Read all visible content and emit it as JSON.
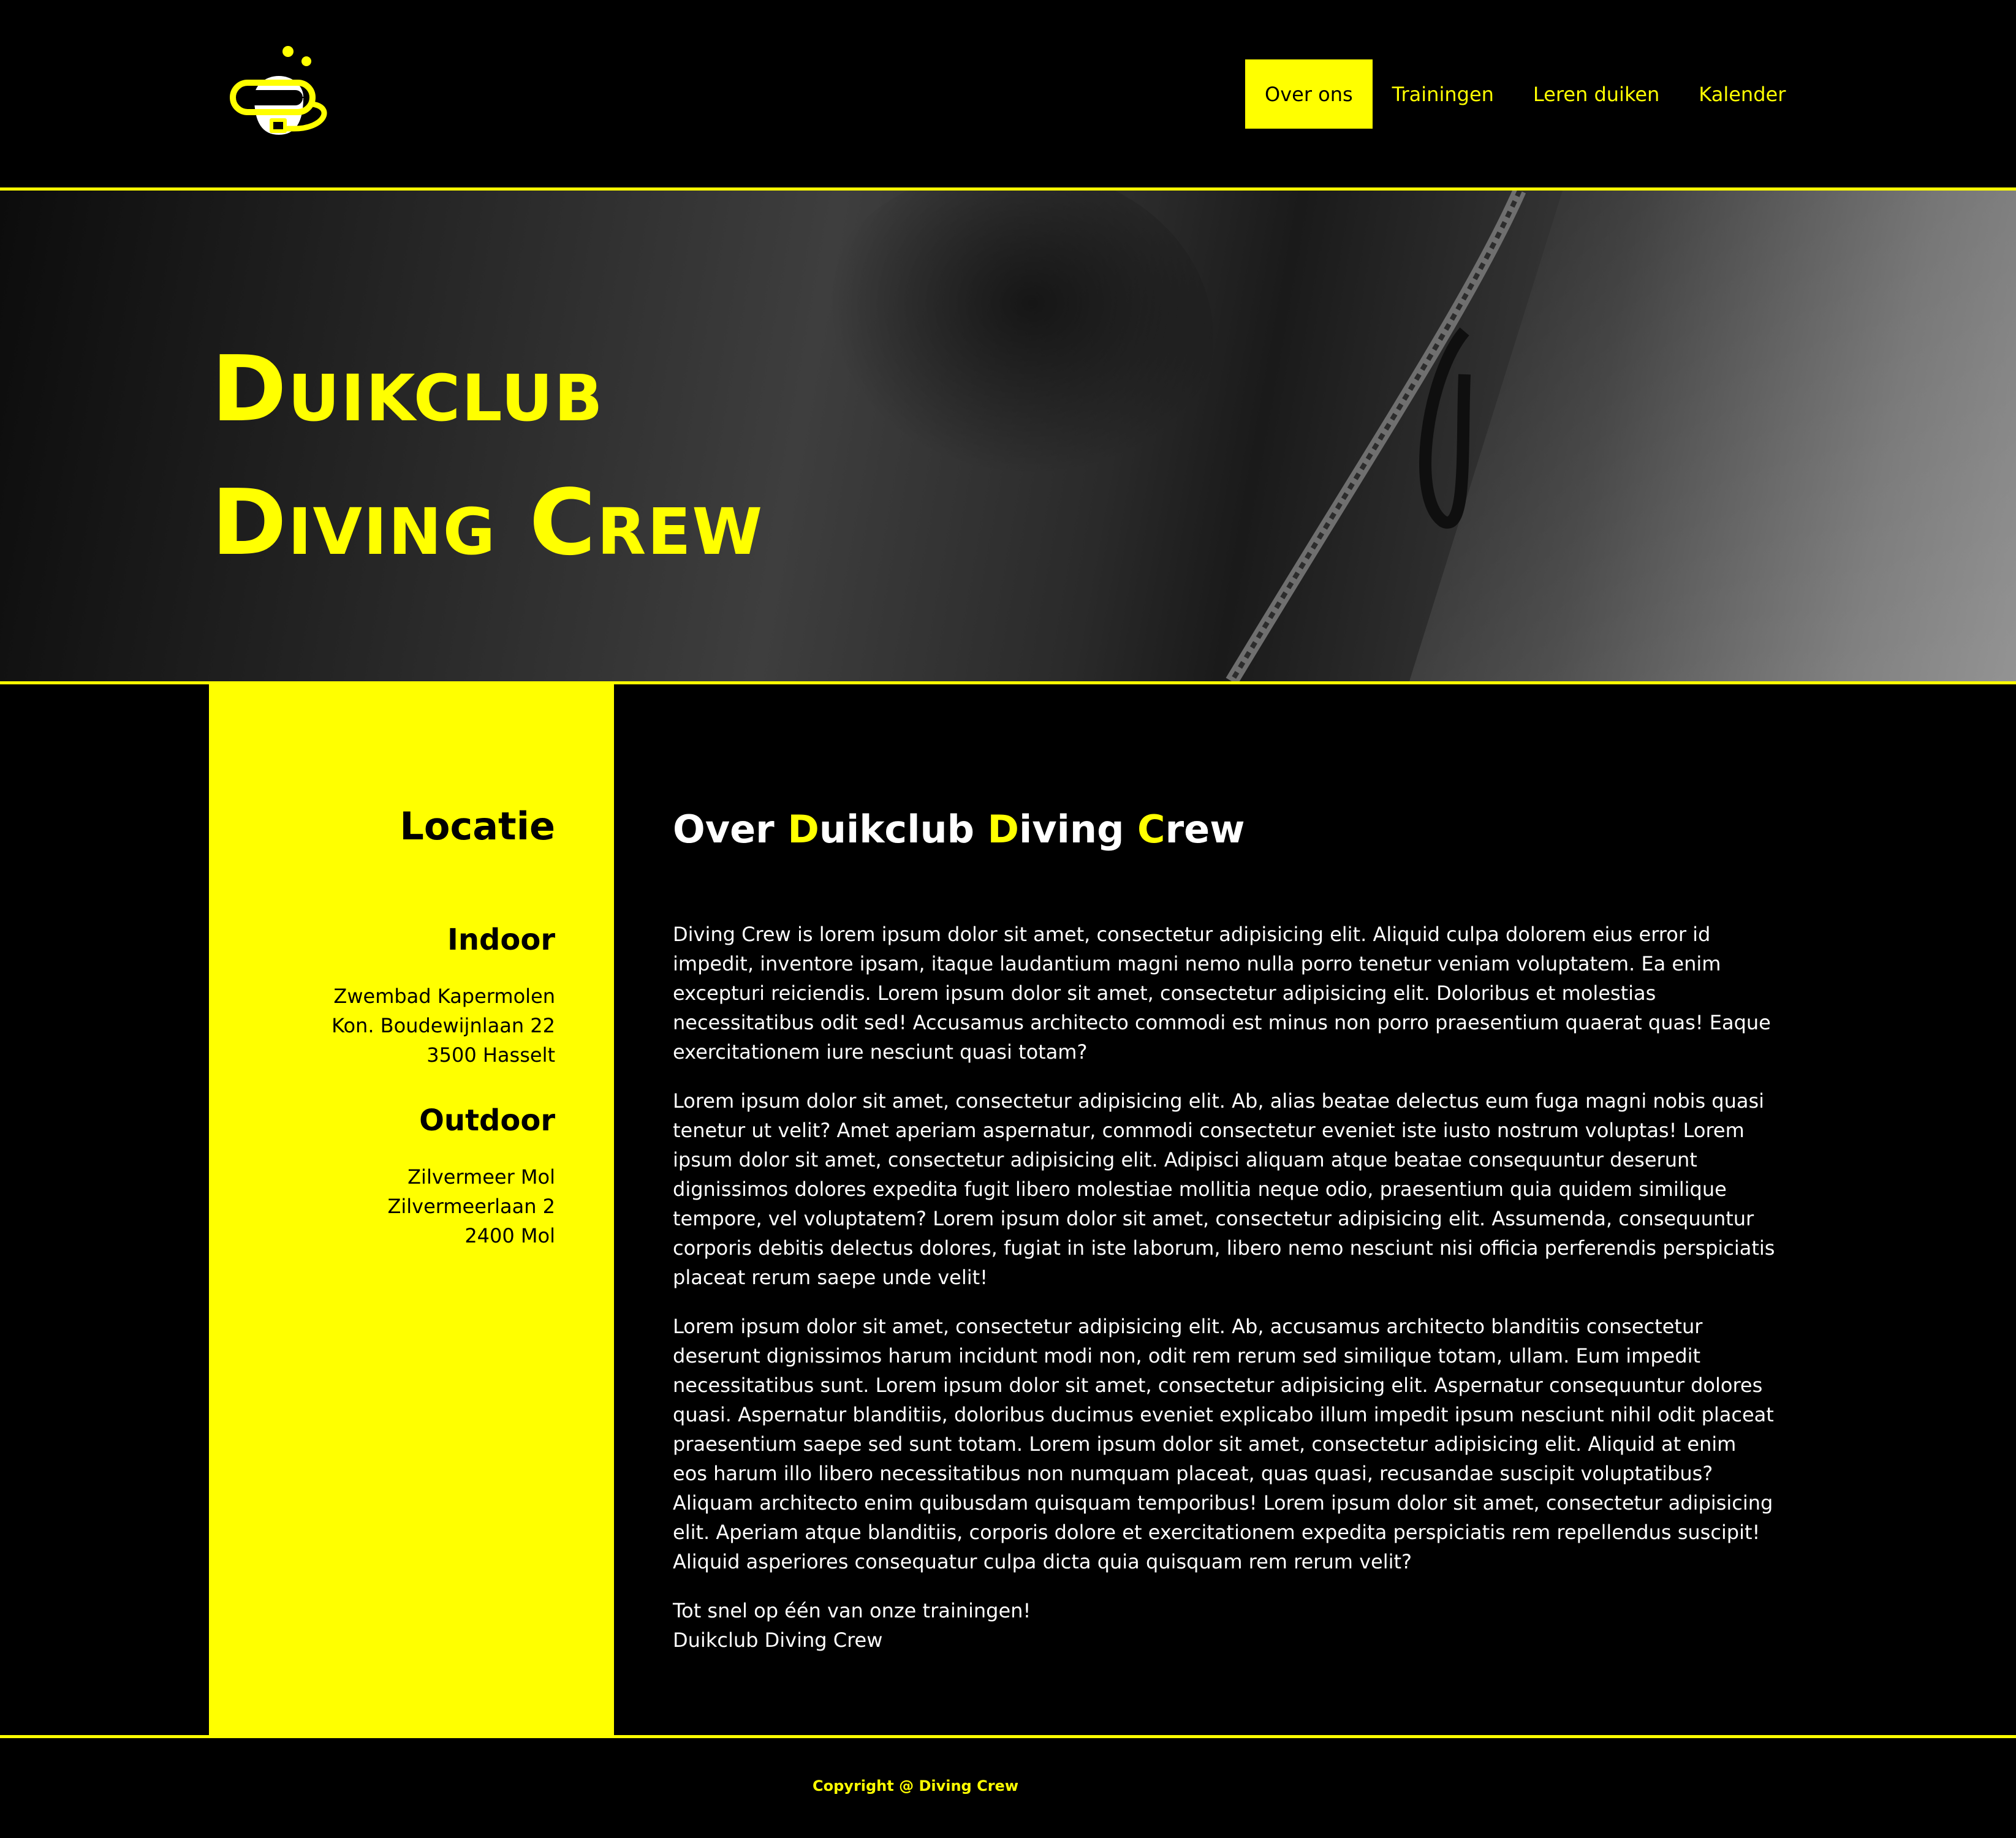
{
  "colors": {
    "accent": "#ffff00",
    "background": "#000000",
    "text": "#ffffff"
  },
  "header": {
    "logo_icon": "diver-mask-snorkel-icon",
    "nav": [
      {
        "label": "Over ons",
        "active": true
      },
      {
        "label": "Trainingen",
        "active": false
      },
      {
        "label": "Leren duiken",
        "active": false
      },
      {
        "label": "Kalender",
        "active": false
      }
    ]
  },
  "hero": {
    "title_line1": "Duikclub",
    "title_line2": "Diving Crew"
  },
  "sidebar": {
    "title": "Locatie",
    "indoor": {
      "heading": "Indoor",
      "lines": [
        "Zwembad Kapermolen",
        "Kon. Boudewijnlaan 22",
        "3500 Hasselt"
      ]
    },
    "outdoor": {
      "heading": "Outdoor",
      "lines": [
        "Zilvermeer Mol",
        "Zilvermeerlaan 2",
        "2400 Mol"
      ]
    }
  },
  "main": {
    "title_parts": [
      "Over ",
      "D",
      "uikclub ",
      "D",
      "iving ",
      "C",
      "rew"
    ],
    "paragraphs": [
      "Diving Crew is lorem ipsum dolor sit amet, consectetur adipisicing elit. Aliquid culpa dolorem eius error id impedit, inventore ipsam, itaque laudantium magni nemo nulla porro tenetur veniam voluptatem. Ea enim excepturi reiciendis. Lorem ipsum dolor sit amet, consectetur adipisicing elit. Doloribus et molestias necessitatibus odit sed! Accusamus architecto commodi est minus non porro praesentium quaerat quas! Eaque exercitationem iure nesciunt quasi totam?",
      "Lorem ipsum dolor sit amet, consectetur adipisicing elit. Ab, alias beatae delectus eum fuga magni nobis quasi tenetur ut velit? Amet aperiam aspernatur, commodi consectetur eveniet iste iusto nostrum voluptas! Lorem ipsum dolor sit amet, consectetur adipisicing elit. Adipisci aliquam atque beatae consequuntur deserunt dignissimos dolores expedita fugit libero molestiae mollitia neque odio, praesentium quia quidem similique tempore, vel voluptatem? Lorem ipsum dolor sit amet, consectetur adipisicing elit. Assumenda, consequuntur corporis debitis delectus dolores, fugiat in iste laborum, libero nemo nesciunt nisi officia perferendis perspiciatis placeat rerum saepe unde velit!",
      "Lorem ipsum dolor sit amet, consectetur adipisicing elit. Ab, accusamus architecto blanditiis consectetur deserunt dignissimos harum incidunt modi non, odit rem rerum sed similique totam, ullam. Eum impedit necessitatibus sunt. Lorem ipsum dolor sit amet, consectetur adipisicing elit. Aspernatur consequuntur dolores quasi. Aspernatur blanditiis, doloribus ducimus eveniet explicabo illum impedit ipsum nesciunt nihil odit placeat praesentium saepe sed sunt totam. Lorem ipsum dolor sit amet, consectetur adipisicing elit. Aliquid at enim eos harum illo libero necessitatibus non numquam placeat, quas quasi, recusandae suscipit voluptatibus? Aliquam architecto enim quibusdam quisquam temporibus! Lorem ipsum dolor sit amet, consectetur adipisicing elit. Aperiam atque blanditiis, corporis dolore et exercitationem expedita perspiciatis rem repellendus suscipit! Aliquid asperiores consequatur culpa dicta quia quisquam rem rerum velit?"
    ],
    "closing_line1": "Tot snel op één van onze trainingen!",
    "closing_line2": "Duikclub Diving Crew"
  },
  "footer": {
    "copyright": "Copyright @ Diving Crew"
  }
}
